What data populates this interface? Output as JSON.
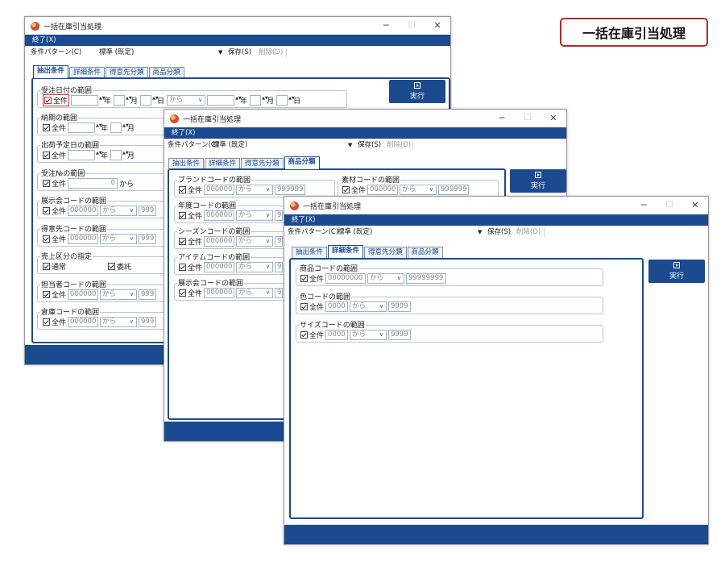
{
  "banner": "一括在庫引当処理",
  "window_title": "一括在庫引当処理",
  "menu": {
    "exit": "終了(X)"
  },
  "toolbar": {
    "pattern_label": "条件パターン(C)",
    "pattern_value": "標準 (既定)",
    "save": "保存(S)",
    "delete": "削除(D)"
  },
  "tabs": [
    "抽出条件",
    "詳細条件",
    "得意先分類",
    "商品分類"
  ],
  "exec_label": "実行",
  "common": {
    "all": "全件",
    "from": "から",
    "year": "年",
    "month": "月",
    "day": "日",
    "code6": "000000",
    "code4": "0000",
    "code8": "00000000",
    "max6": "999999",
    "max4": "9999",
    "max8": "99999999",
    "max4b": "9999"
  },
  "win1": {
    "order_date": "受注日付の範囲",
    "delivery": "納期の範囲",
    "ship_date": "出荷予定日の範囲",
    "order_no": "受注№の範囲",
    "order_no_from": "0",
    "exhibit": "展示会コードの範囲",
    "customer": "得意先コードの範囲",
    "sales_type": "売上区分の指定",
    "normal": "通常",
    "consign": "委託",
    "staff": "担当者コードの範囲",
    "warehouse": "倉庫コードの範囲",
    "trunc": "999"
  },
  "win2": {
    "brand": "ブランドコードの範囲",
    "material": "素材コードの範囲",
    "year": "年度コードの範囲",
    "season": "シーズンコードの範囲",
    "item": "アイテムコードの範囲",
    "exhibit": "展示会コードの範囲",
    "trunc": "9"
  },
  "win3": {
    "product": "商品コードの範囲",
    "color": "色コードの範囲",
    "size": "サイズコードの範囲"
  }
}
